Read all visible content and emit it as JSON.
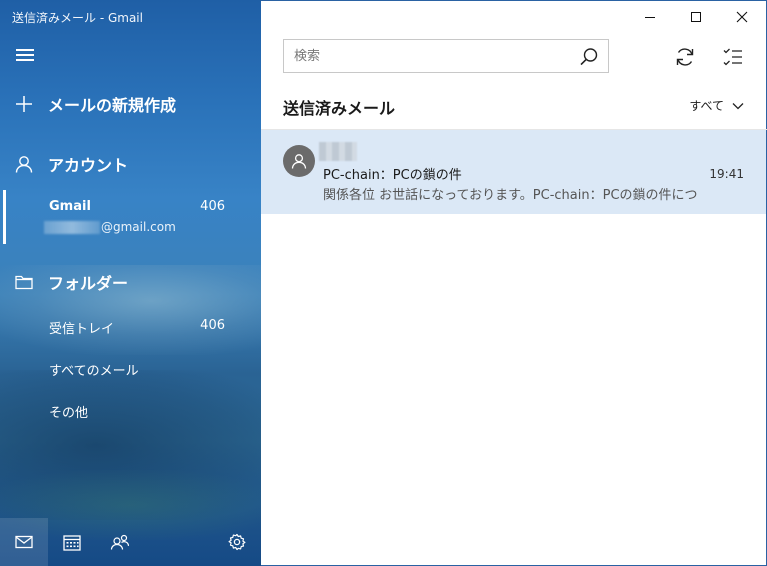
{
  "window": {
    "title": "送信済みメール - Gmail"
  },
  "sidebar": {
    "menu_icon": "hamburger-icon",
    "new_mail_label": "メールの新規作成",
    "accounts_heading": "アカウント",
    "account": {
      "name": "Gmail",
      "unread_count": "406",
      "email": "@gmail.com"
    },
    "folders_heading": "フォルダー",
    "folders": [
      {
        "label": "受信トレイ",
        "count": "406"
      },
      {
        "label": "すべてのメール",
        "count": ""
      },
      {
        "label": "その他",
        "count": ""
      }
    ],
    "bottom_icons": [
      "mail-icon",
      "calendar-icon",
      "people-icon",
      "settings-icon"
    ]
  },
  "main": {
    "search": {
      "placeholder": "検索",
      "value": ""
    },
    "folder_title": "送信済みメール",
    "filter_label": "すべて",
    "messages": [
      {
        "subject": "PC-chain：PCの鎖の件",
        "time": "19:41",
        "preview": "関係各位 お世話になっております。PC-chain：PCの鎖の件につ"
      }
    ]
  },
  "colors": {
    "sidebar_blue": "#2a72b9",
    "selected_message_bg": "#dbe8f6",
    "avatar_gray": "#6b6b6b"
  }
}
